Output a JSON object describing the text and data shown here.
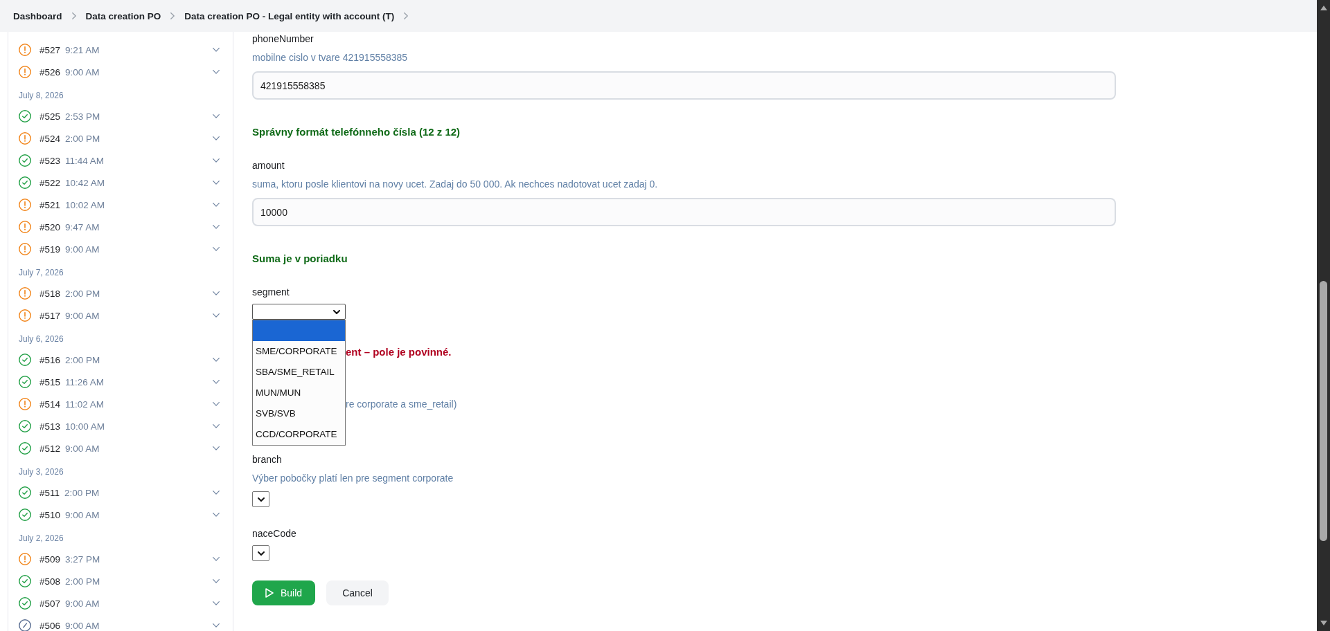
{
  "breadcrumb": [
    {
      "label": "Dashboard"
    },
    {
      "label": "Data creation PO"
    },
    {
      "label": "Data creation PO - Legal entity with account (T)"
    }
  ],
  "sidebar": {
    "groups": [
      {
        "runs": [
          {
            "number": "#527",
            "time": "9:21 AM",
            "kind": "warning",
            "expanded": false
          },
          {
            "number": "#526",
            "time": "9:00 AM",
            "kind": "warning",
            "expanded": false
          }
        ]
      },
      {
        "date": "July 8, 2026",
        "runs": [
          {
            "number": "#525",
            "time": "2:53 PM",
            "kind": "success",
            "expanded": false
          },
          {
            "number": "#524",
            "time": "2:00 PM",
            "kind": "warning",
            "expanded": false
          },
          {
            "number": "#523",
            "time": "11:44 AM",
            "kind": "success",
            "expanded": false
          },
          {
            "number": "#522",
            "time": "10:42 AM",
            "kind": "success",
            "expanded": false
          },
          {
            "number": "#521",
            "time": "10:02 AM",
            "kind": "warning",
            "expanded": false
          },
          {
            "number": "#520",
            "time": "9:47 AM",
            "kind": "warning",
            "expanded": false
          },
          {
            "number": "#519",
            "time": "9:00 AM",
            "kind": "warning",
            "expanded": false
          }
        ]
      },
      {
        "date": "July 7, 2026",
        "runs": [
          {
            "number": "#518",
            "time": "2:00 PM",
            "kind": "warning",
            "expanded": false
          },
          {
            "number": "#517",
            "time": "9:00 AM",
            "kind": "warning",
            "expanded": false
          }
        ]
      },
      {
        "date": "July 6, 2026",
        "runs": [
          {
            "number": "#516",
            "time": "2:00 PM",
            "kind": "success",
            "expanded": false
          },
          {
            "number": "#515",
            "time": "11:26 AM",
            "kind": "success",
            "expanded": false
          },
          {
            "number": "#514",
            "time": "11:02 AM",
            "kind": "warning",
            "expanded": false
          },
          {
            "number": "#513",
            "time": "10:00 AM",
            "kind": "success",
            "expanded": false
          },
          {
            "number": "#512",
            "time": "9:00 AM",
            "kind": "success",
            "expanded": false
          }
        ]
      },
      {
        "date": "July 3, 2026",
        "runs": [
          {
            "number": "#511",
            "time": "2:00 PM",
            "kind": "success",
            "expanded": false
          },
          {
            "number": "#510",
            "time": "9:00 AM",
            "kind": "success",
            "expanded": false
          }
        ]
      },
      {
        "date": "July 2, 2026",
        "runs": [
          {
            "number": "#509",
            "time": "3:27 PM",
            "kind": "warning",
            "expanded": false
          },
          {
            "number": "#508",
            "time": "2:00 PM",
            "kind": "success",
            "expanded": false
          },
          {
            "number": "#507",
            "time": "9:00 AM",
            "kind": "success",
            "expanded": false
          },
          {
            "number": "#506",
            "time": "9:00 AM",
            "kind": "running",
            "expanded": false
          }
        ]
      }
    ]
  },
  "form": {
    "fields": [
      {
        "kind": "text",
        "label": "phoneNumber",
        "hint": "mobilne cislo v tvare 421915558385",
        "value": "421915558385",
        "message": {
          "kind": "success",
          "text": "Správny formát telefónneho čísla (12 z 12)"
        }
      },
      {
        "kind": "text",
        "label": "amount",
        "hint": "suma, ktoru posle klientovi na novy ucet. Zadaj do 50 000. Ak nechces nadotovat ucet zadaj 0.",
        "value": "10000",
        "message": {
          "kind": "success",
          "text": "Suma je v poriadku"
        }
      },
      {
        "kind": "select",
        "label": "segment",
        "open": true,
        "options": [
          {
            "selected": true
          },
          {
            "label": "SME/CORPORATE",
            "selected": false
          },
          {
            "label": "SBA/SME_RETAIL",
            "selected": false
          },
          {
            "label": "MUN/MUN",
            "selected": false
          },
          {
            "label": "SVB/SVB",
            "selected": false
          },
          {
            "label": "CCD/CORPORATE",
            "selected": false
          }
        ],
        "message": {
          "kind": "error",
          "text": "ent – pole je povinné."
        }
      },
      {
        "kind": "fragment",
        "hint": "re corporate a sme_retail)"
      },
      {
        "kind": "select",
        "label": "branch",
        "hint": "Výber pobočky platí len pre segment corporate",
        "open": false
      },
      {
        "kind": "select",
        "label": "naceCode",
        "open": false
      }
    ]
  },
  "actions": [
    {
      "label": "Build",
      "kind": "primary"
    },
    {
      "label": "Cancel",
      "kind": "secondary"
    }
  ]
}
